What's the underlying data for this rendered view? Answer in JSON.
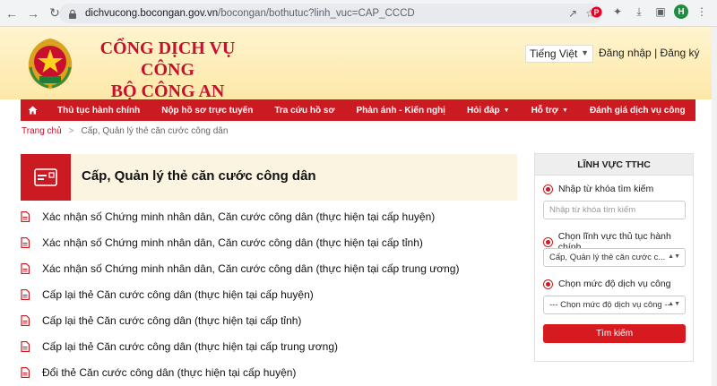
{
  "browser": {
    "url_host": "dichvucong.bocongan.gov.vn",
    "url_path": "/bocongan/bothutuc?linh_vuc=CAP_CCCD",
    "avatar_letter": "H"
  },
  "header": {
    "title_line1": "CỔNG DỊCH VỤ CÔNG",
    "title_line2": "BỘ CÔNG AN",
    "language": "Tiếng Việt",
    "login": "Đăng nhập",
    "separator": "|",
    "register": "Đăng ký"
  },
  "menu": {
    "items": [
      {
        "label": "Thủ tục hành chính"
      },
      {
        "label": "Nộp hồ sơ trực tuyến"
      },
      {
        "label": "Tra cứu hồ sơ"
      },
      {
        "label": "Phản ánh - Kiến nghị"
      },
      {
        "label": "Hỏi đáp"
      },
      {
        "label": "Hỗ trợ"
      },
      {
        "label": "Đánh giá dịch vụ công"
      }
    ]
  },
  "breadcrumb": {
    "home": "Trang chủ",
    "separator": ">",
    "current": "Cấp, Quản lý thẻ căn cước công dân"
  },
  "main": {
    "heading": "Cấp, Quản lý thẻ căn cước công dân",
    "procedures": [
      "Xác nhận số Chứng minh nhân dân, Căn cước công dân (thực hiện tại cấp huyện)",
      "Xác nhận số Chứng minh nhân dân, Căn cước công dân (thực hiện tại cấp tỉnh)",
      "Xác nhận số Chứng minh nhân dân, Căn cước công dân (thực hiện tại cấp trung ương)",
      "Cấp lại thẻ Căn cước công dân (thực hiện tại cấp huyện)",
      "Cấp lại thẻ Căn cước công dân (thực hiện tại cấp tỉnh)",
      "Cấp lại thẻ Căn cước công dân (thực hiện tại cấp trung ương)",
      "Đổi thẻ Căn cước công dân (thực hiện tại cấp huyện)"
    ]
  },
  "sidebar": {
    "title": "LĨNH VỰC TTHC",
    "keyword_label": "Nhập từ khóa tìm kiếm",
    "keyword_placeholder": "Nhập từ khóa tìm kiếm",
    "field_label": "Chọn lĩnh vực thủ tục hành chính",
    "field_value": "Cấp, Quản lý thẻ căn cước c...",
    "level_label": "Chọn mức độ dịch vụ công",
    "level_value": "--- Chọn mức độ dịch vụ công ---",
    "search_button": "Tìm kiếm"
  },
  "colors": {
    "brand_red": "#cc1a22",
    "header_gold": "#fde8a8"
  }
}
